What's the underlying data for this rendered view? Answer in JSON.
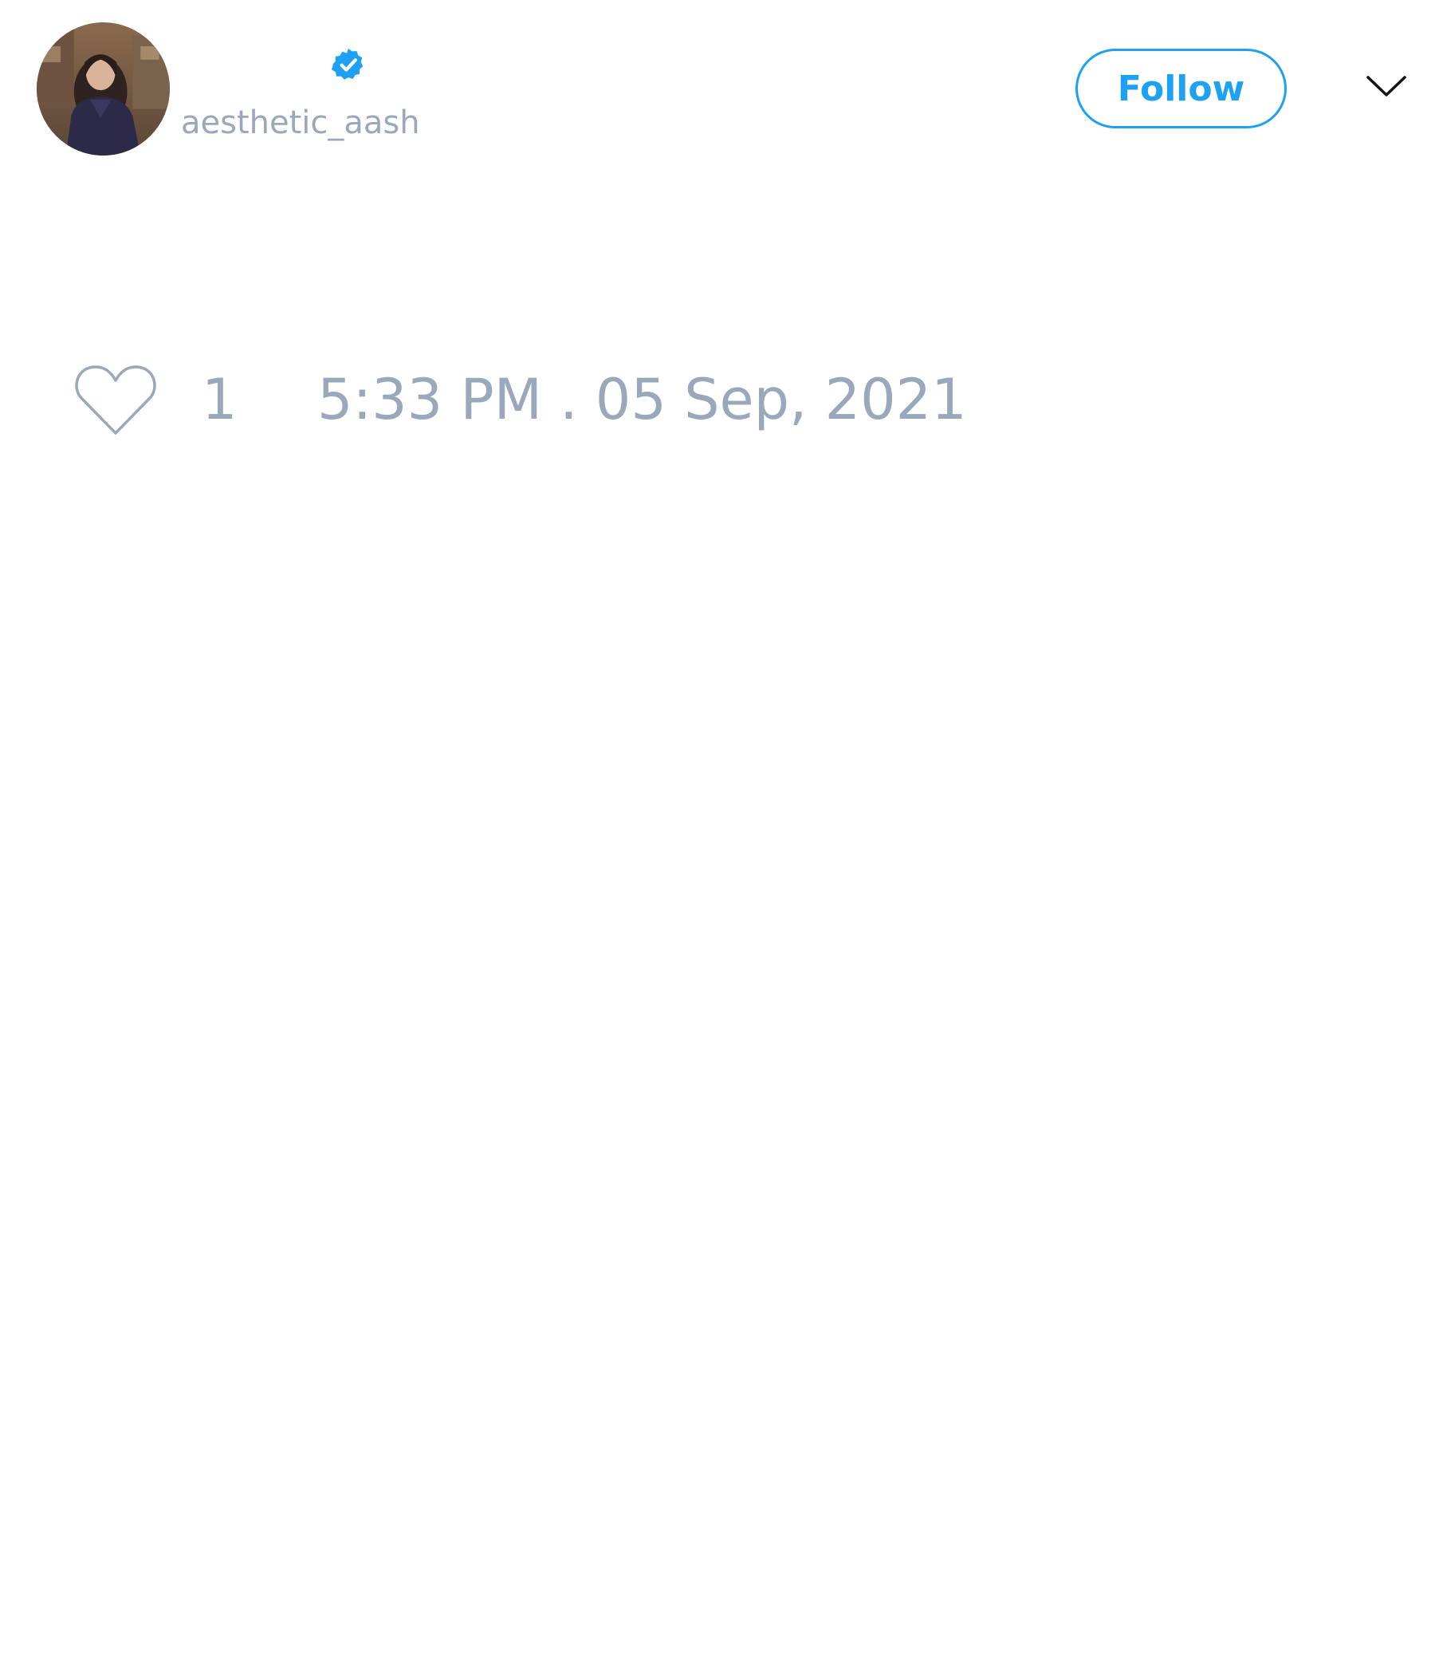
{
  "author": {
    "avatar_icon": "user-avatar-photo",
    "verified_icon": "verified-badge-icon",
    "handle": "aesthetic_aash"
  },
  "actions": {
    "follow_label": "Follow",
    "menu_icon": "chevron-down-icon"
  },
  "stats": {
    "like_icon": "heart-outline-icon",
    "like_count": "1",
    "timestamp": "5:33 PM . 05 Sep, 2021"
  },
  "colors": {
    "accent": "#1da1f2",
    "muted_text": "#9aa8bb",
    "background": "#ffffff"
  }
}
